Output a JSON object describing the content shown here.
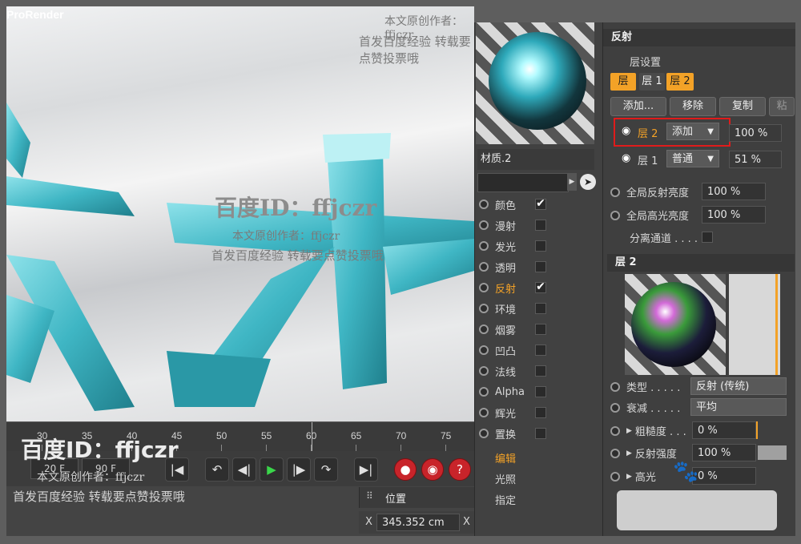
{
  "viewport": {
    "title": "ProRender"
  },
  "timeline": {
    "ticks": [
      "30",
      "35",
      "40",
      "45",
      "50",
      "55",
      "60",
      "65",
      "70",
      "75"
    ],
    "frame_start": "20 F",
    "frame_end": "90 F"
  },
  "coords": {
    "position_label": "位置",
    "x_label": "X",
    "x_value": "345.352 cm",
    "x2_label": "X"
  },
  "material": {
    "name": "材质.2",
    "channels": [
      {
        "label": "颜色",
        "checked": true
      },
      {
        "label": "漫射",
        "checked": false
      },
      {
        "label": "发光",
        "checked": false
      },
      {
        "label": "透明",
        "checked": false
      },
      {
        "label": "反射",
        "checked": true
      },
      {
        "label": "环境",
        "checked": false
      },
      {
        "label": "烟雾",
        "checked": false
      },
      {
        "label": "凹凸",
        "checked": false
      },
      {
        "label": "法线",
        "checked": false
      },
      {
        "label": "Alpha",
        "checked": false
      },
      {
        "label": "辉光",
        "checked": false
      },
      {
        "label": "置换",
        "checked": false
      }
    ],
    "extra": [
      "编辑",
      "光照",
      "指定"
    ],
    "check_mark": "✔"
  },
  "reflectance": {
    "header": "反射",
    "layer_settings": "层设置",
    "tabs": [
      "层",
      "层 1",
      "层 2"
    ],
    "buttons": [
      "添加...",
      "移除",
      "复制",
      "粘"
    ],
    "layer2": {
      "name": "层 2",
      "mode": "添加",
      "value": "100 %"
    },
    "layer1": {
      "name": "层 1",
      "mode": "普通",
      "value": "51 %"
    },
    "global_reflect": {
      "label": "全局反射亮度",
      "value": "100 %"
    },
    "global_spec": {
      "label": "全局高光亮度",
      "value": "100 %"
    },
    "separate": "分离通道 . . . ."
  },
  "layer2_panel": {
    "header": "层 2",
    "type_label": "类型 . . . . .",
    "type_value": "反射 (传统)",
    "atten_label": "衰减 . . . . .",
    "atten_value": "平均",
    "rough_label": "粗糙度 . . .",
    "rough_value": "0 %",
    "reflect_label": "反射强度",
    "reflect_value": "100 %",
    "spec_label": "高光",
    "spec_value": "0 %"
  },
  "watermarks": {
    "id1": "百度ID：ffjczr",
    "line1": "本文原创作者：ffjczr",
    "line2": "首发百度经验  转载要点赞投票哦",
    "top_line1": "本文原创作者：ffjczr",
    "top_line2": "首发百度经验  转载要点赞投票哦"
  },
  "colors": {
    "accent": "#f3a227",
    "highlight_box": "#e01b1b",
    "glass_text": "#4cc3d0"
  }
}
